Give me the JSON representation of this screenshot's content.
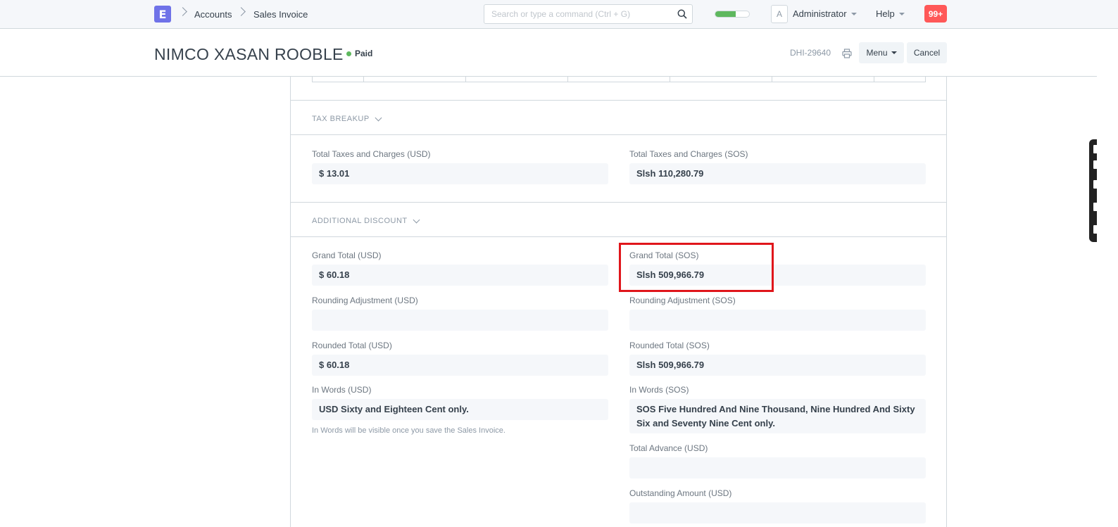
{
  "navbar": {
    "logo_letter": "E",
    "breadcrumbs": [
      "Accounts",
      "Sales Invoice"
    ],
    "search_placeholder": "Search or type a command (Ctrl + G)",
    "progress_fraction": 0.6,
    "avatar_letter": "A",
    "user_label": "Administrator",
    "help_label": "Help",
    "notifications": "99+"
  },
  "page_head": {
    "title": "NIMCO XASAN ROOBLE",
    "status": "Paid",
    "doc_id": "DHI-29640",
    "menu_label": "Menu",
    "cancel_label": "Cancel"
  },
  "sections": {
    "tax_breakup": "TAX BREAKUP",
    "additional_discount": "ADDITIONAL DISCOUNT"
  },
  "fields": {
    "total_taxes_usd": {
      "label": "Total Taxes and Charges (USD)",
      "value": "$ 13.01"
    },
    "total_taxes_sos": {
      "label": "Total Taxes and Charges (SOS)",
      "value": "Slsh 110,280.79"
    },
    "grand_total_usd": {
      "label": "Grand Total (USD)",
      "value": "$ 60.18"
    },
    "grand_total_sos": {
      "label": "Grand Total (SOS)",
      "value": "Slsh 509,966.79"
    },
    "rounding_usd": {
      "label": "Rounding Adjustment (USD)",
      "value": ""
    },
    "rounding_sos": {
      "label": "Rounding Adjustment (SOS)",
      "value": ""
    },
    "rounded_total_usd": {
      "label": "Rounded Total (USD)",
      "value": "$ 60.18"
    },
    "rounded_total_sos": {
      "label": "Rounded Total (SOS)",
      "value": "Slsh 509,966.79"
    },
    "in_words_usd": {
      "label": "In Words (USD)",
      "value": "USD Sixty and Eighteen Cent only.",
      "help": "In Words will be visible once you save the Sales Invoice."
    },
    "in_words_sos": {
      "label": "In Words (SOS)",
      "value": "SOS Five Hundred And Nine Thousand, Nine Hundred And Sixty Six and Seventy Nine Cent only."
    },
    "total_advance_usd": {
      "label": "Total Advance (USD)",
      "value": ""
    },
    "outstanding_usd": {
      "label": "Outstanding Amount (USD)",
      "value": ""
    }
  },
  "colors": {
    "accent": "#6f72e8",
    "paid": "#5eb85e",
    "notification": "#ff5858",
    "highlight": "#e0161b"
  }
}
